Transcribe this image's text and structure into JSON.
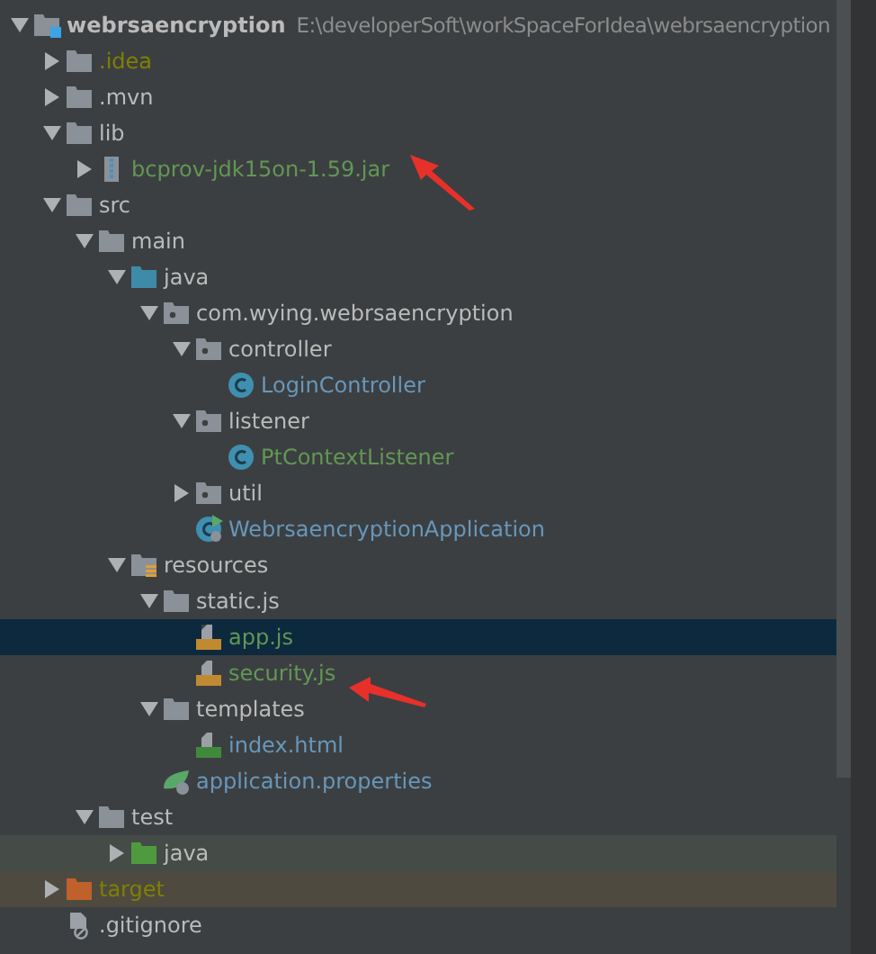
{
  "tree": [
    {
      "label": "webrsaencryption",
      "path": "E:\\developerSoft\\workSpaceForIdea\\webrsaencryption",
      "kind": "module",
      "color": "#bbbbbb",
      "expanded": true,
      "selected": false,
      "children": [
        {
          "label": ".idea",
          "kind": "folder",
          "color": "#808000",
          "expanded": false,
          "selected": false
        },
        {
          "label": ".mvn",
          "kind": "folder",
          "color": "#bbbbbb",
          "expanded": false,
          "selected": false
        },
        {
          "label": "lib",
          "kind": "folder",
          "color": "#bbbbbb",
          "expanded": true,
          "selected": false,
          "children": [
            {
              "label": "bcprov-jdk15on-1.59.jar",
              "kind": "jar",
              "color": "#629755",
              "expanded": false,
              "selected": false
            }
          ]
        },
        {
          "label": "src",
          "kind": "folder",
          "color": "#bbbbbb",
          "expanded": true,
          "selected": false,
          "children": [
            {
              "label": "main",
              "kind": "folder",
              "color": "#bbbbbb",
              "expanded": true,
              "selected": false,
              "children": [
                {
                  "label": "java",
                  "kind": "sources",
                  "color": "#bbbbbb",
                  "expanded": true,
                  "selected": false,
                  "children": [
                    {
                      "label": "com.wying.webrsaencryption",
                      "kind": "package",
                      "color": "#bbbbbb",
                      "expanded": true,
                      "selected": false,
                      "children": [
                        {
                          "label": "controller",
                          "kind": "package",
                          "color": "#bbbbbb",
                          "expanded": true,
                          "selected": false,
                          "children": [
                            {
                              "label": "LoginController",
                              "kind": "class",
                              "color": "#6897bb",
                              "selected": false
                            }
                          ]
                        },
                        {
                          "label": "listener",
                          "kind": "package",
                          "color": "#bbbbbb",
                          "expanded": true,
                          "selected": false,
                          "children": [
                            {
                              "label": "PtContextListener",
                              "kind": "class",
                              "color": "#629755",
                              "selected": false
                            }
                          ]
                        },
                        {
                          "label": "util",
                          "kind": "package",
                          "color": "#bbbbbb",
                          "expanded": false,
                          "selected": false
                        },
                        {
                          "label": "WebrsaencryptionApplication",
                          "kind": "application",
                          "color": "#6897bb",
                          "selected": false
                        }
                      ]
                    }
                  ]
                },
                {
                  "label": "resources",
                  "kind": "resources",
                  "color": "#bbbbbb",
                  "expanded": true,
                  "selected": false,
                  "children": [
                    {
                      "label": "static.js",
                      "kind": "folder",
                      "color": "#bbbbbb",
                      "expanded": true,
                      "selected": false,
                      "children": [
                        {
                          "label": "app.js",
                          "kind": "script",
                          "color": "#629755",
                          "selected": true
                        },
                        {
                          "label": "security.js",
                          "kind": "script",
                          "color": "#629755",
                          "selected": false
                        }
                      ]
                    },
                    {
                      "label": "templates",
                      "kind": "folder",
                      "color": "#bbbbbb",
                      "expanded": true,
                      "selected": false,
                      "children": [
                        {
                          "label": "index.html",
                          "kind": "html",
                          "color": "#6897bb",
                          "selected": false
                        }
                      ]
                    },
                    {
                      "label": "application.properties",
                      "kind": "properties",
                      "color": "#6897bb",
                      "selected": false
                    }
                  ]
                }
              ]
            },
            {
              "label": "test",
              "kind": "folder",
              "color": "#bbbbbb",
              "expanded": true,
              "selected": false,
              "children": [
                {
                  "label": "java",
                  "kind": "tests",
                  "color": "#bbbbbb",
                  "expanded": false,
                  "selected": false
                }
              ]
            }
          ]
        },
        {
          "label": "target",
          "kind": "excluded",
          "color": "#808000",
          "expanded": false,
          "selected": false
        },
        {
          "label": ".gitignore",
          "kind": "ignore",
          "color": "#bbbbbb",
          "selected": false
        }
      ]
    }
  ]
}
